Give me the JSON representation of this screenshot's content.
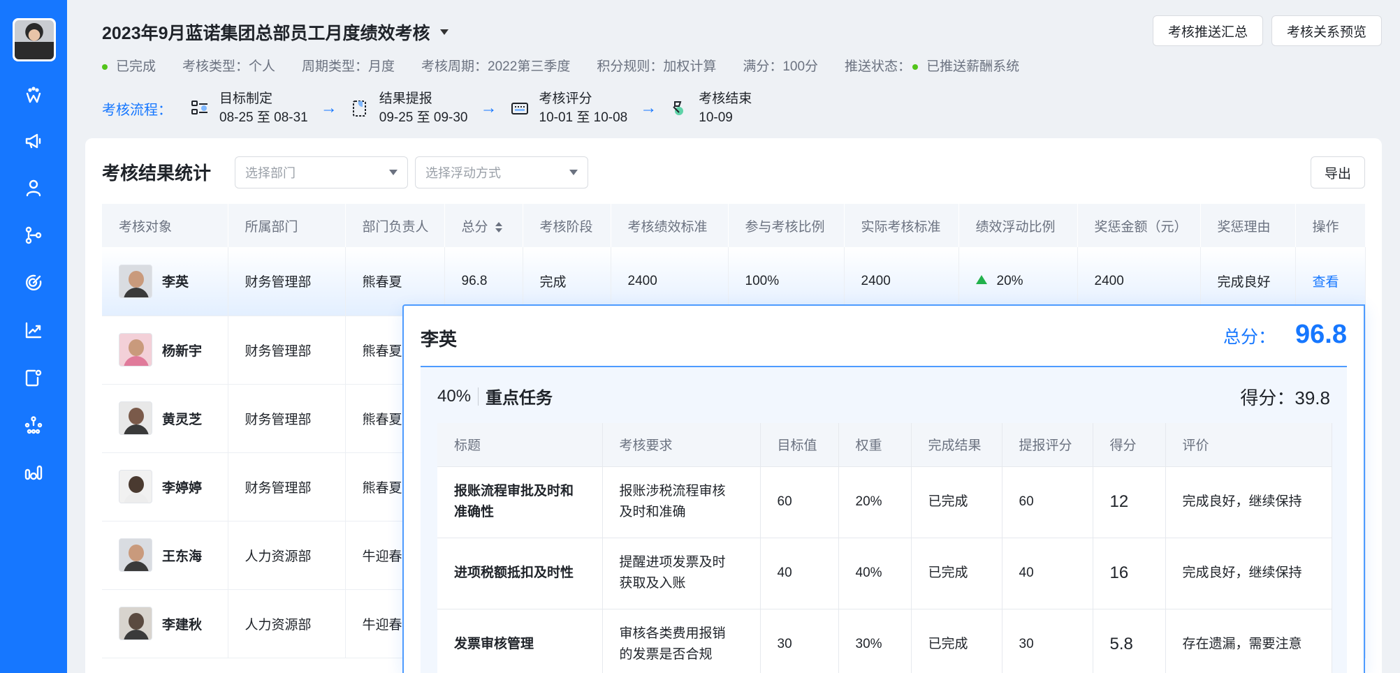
{
  "sidebar": {
    "icons": [
      "w-logo-icon",
      "megaphone-icon",
      "user-icon",
      "org-chart-icon",
      "target-icon",
      "trend-chart-icon",
      "edit-doc-icon",
      "network-icon",
      "bar-stats-icon"
    ]
  },
  "header": {
    "title": "2023年9月蓝诺集团总部员工月度绩效考核",
    "meta": {
      "status": "已完成",
      "type": "考核类型：个人",
      "period_type": "周期类型：月度",
      "period": "考核周期：2022第三季度",
      "rule": "积分规则：加权计算",
      "full": "满分：100分",
      "push_label": "推送状态：",
      "push_value": "已推送薪酬系统"
    },
    "btn_push_summary": "考核推送汇总",
    "btn_relation_preview": "考核关系预览",
    "flow_label": "考核流程：",
    "flow": [
      {
        "name": "目标制定",
        "date": "08-25 至 08-31"
      },
      {
        "name": "结果提报",
        "date": "09-25 至 09-30"
      },
      {
        "name": "考核评分",
        "date": "10-01 至 10-08"
      },
      {
        "name": "考核结束",
        "date": "10-09"
      }
    ]
  },
  "card": {
    "title": "考核结果统计",
    "select_dept_placeholder": "选择部门",
    "select_float_placeholder": "选择浮动方式",
    "export": "导出",
    "columns": [
      "考核对象",
      "所属部门",
      "部门负责人",
      "总分",
      "考核阶段",
      "考核绩效标准",
      "参与考核比例",
      "实际考核标准",
      "绩效浮动比例",
      "奖惩金额（元）",
      "奖惩理由",
      "操作"
    ],
    "rows": [
      {
        "name": "李英",
        "dept": "财务管理部",
        "head": "熊春夏",
        "score": "96.8",
        "stage": "完成",
        "std": "2400",
        "ratio": "100%",
        "actual": "2400",
        "float": "20%",
        "amount": "2400",
        "reason": "完成良好",
        "op": "查看"
      },
      {
        "name": "杨新宇",
        "dept": "财务管理部",
        "head": "熊春夏"
      },
      {
        "name": "黄灵芝",
        "dept": "财务管理部",
        "head": "熊春夏"
      },
      {
        "name": "李婷婷",
        "dept": "财务管理部",
        "head": "熊春夏"
      },
      {
        "name": "王东海",
        "dept": "人力资源部",
        "head": "牛迎春"
      },
      {
        "name": "李建秋",
        "dept": "人力资源部",
        "head": "牛迎春"
      }
    ]
  },
  "popup": {
    "name": "李英",
    "total_label": "总分：",
    "total_value": "96.8",
    "section_pct": "40%",
    "section_name": "重点任务",
    "section_score": "得分：39.8",
    "columns": [
      "标题",
      "考核要求",
      "目标值",
      "权重",
      "完成结果",
      "提报评分",
      "得分",
      "评价"
    ],
    "rows": [
      {
        "title1": "报账流程审批及时和",
        "title2": "准确性",
        "req1": "报账涉税流程审核",
        "req2": "及时和准确",
        "target": "60",
        "weight": "20%",
        "result": "已完成",
        "report": "60",
        "score": "12",
        "comment": "完成良好，继续保持"
      },
      {
        "title1": "进项税额抵扣及时性",
        "title2": "",
        "req1": "提醒进项发票及时",
        "req2": "获取及入账",
        "target": "40",
        "weight": "40%",
        "result": "已完成",
        "report": "40",
        "score": "16",
        "comment": "完成良好，继续保持"
      },
      {
        "title1": "发票审核管理",
        "title2": "",
        "req1": "审核各类费用报销",
        "req2": "的发票是否合规",
        "target": "30",
        "weight": "30%",
        "result": "已完成",
        "report": "30",
        "score": "5.8",
        "comment": "存在遗漏，需要注意"
      }
    ]
  }
}
